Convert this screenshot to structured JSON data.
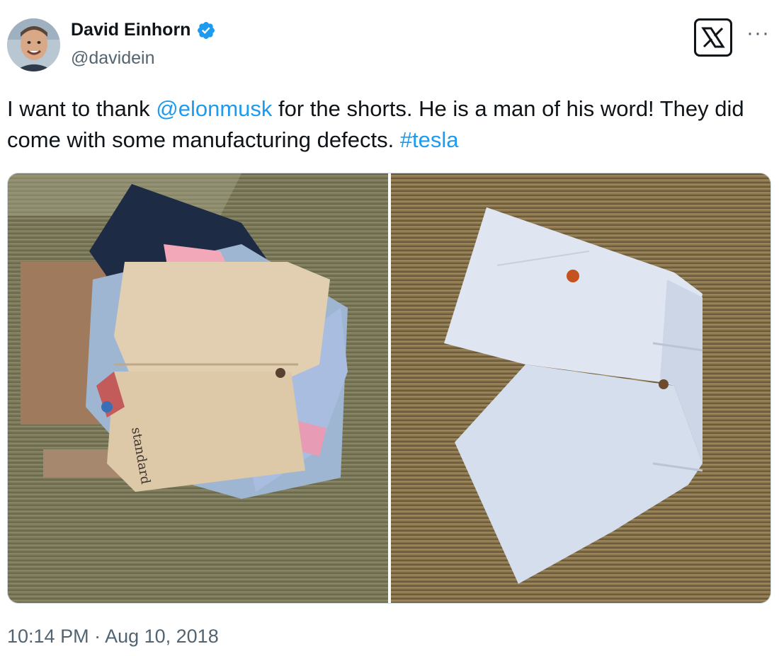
{
  "author": {
    "name": "David Einhorn",
    "handle": "@davidein",
    "verified": true,
    "verified_color": "#1d9bf0",
    "avatar_icon": "avatar-photo"
  },
  "header_actions": {
    "brand_logo": "x-logo-icon",
    "more_icon": "more-dots-icon",
    "more_label": "···"
  },
  "tweet": {
    "text_before": "I want to thank ",
    "mention": "@elonmusk",
    "text_middle": " for the shorts. He is a man of his word!  They did come with some manufacturing defects. ",
    "hashtag": "#tesla",
    "link_color": "#1d9bf0"
  },
  "media": {
    "count": 2,
    "photos": [
      {
        "description_icon": "photo-pile-of-shorts",
        "printed_text": "standard"
      },
      {
        "description_icon": "photo-light-blue-shorts"
      }
    ]
  },
  "timestamp": "10:14 PM · Aug 10, 2018"
}
